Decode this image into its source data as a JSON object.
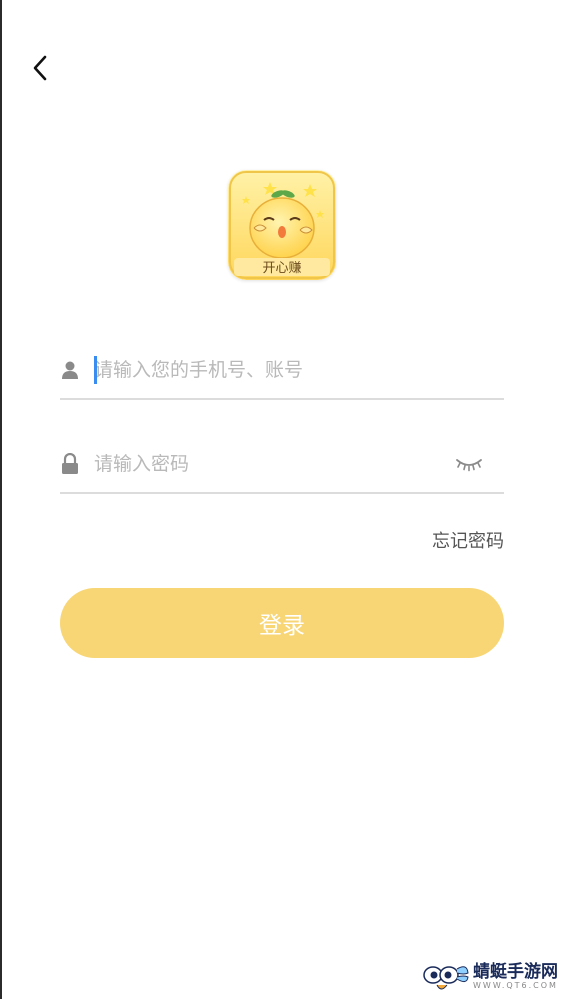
{
  "app": {
    "logo_text": "开心赚"
  },
  "login": {
    "username_placeholder": "请输入您的手机号、账号",
    "password_placeholder": "请输入密码",
    "forgot_password": "忘记密码",
    "submit_label": "登录"
  },
  "watermark": {
    "site_name": "蜻蜓手游网",
    "site_url": "WWW.QT6.COM"
  },
  "colors": {
    "accent": "#f8d676",
    "input_cursor": "#3b8cf0",
    "divider": "#dcdcdc"
  },
  "icons": {
    "back": "chevron-left-icon",
    "username": "user-icon",
    "password": "lock-icon",
    "visibility": "eye-closed-icon"
  }
}
